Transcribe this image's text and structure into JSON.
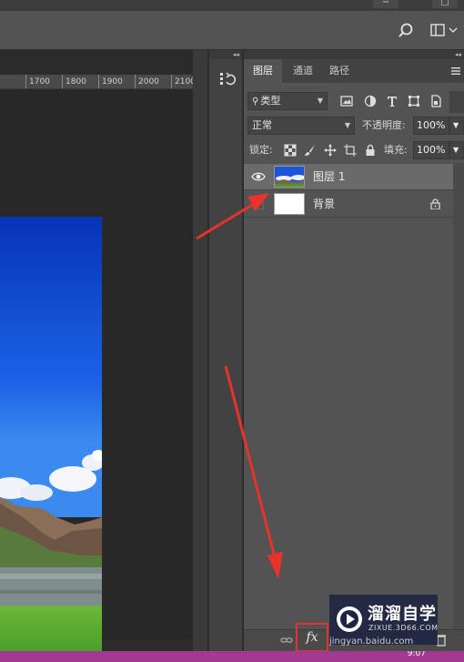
{
  "panel": {
    "tabs": [
      "图层",
      "通道",
      "路径"
    ],
    "filter_kind": "类型",
    "blend_mode": "正常",
    "opacity_label": "不透明度:",
    "opacity_value": "100%",
    "lock_label": "锁定:",
    "fill_label": "填充:",
    "fill_value": "100%",
    "layers": [
      {
        "name": "图层 1",
        "selected": true,
        "visible": true
      },
      {
        "name": "背景",
        "selected": false,
        "visible": false,
        "locked": true
      }
    ],
    "fx_label": "fx"
  },
  "ruler": {
    "ticks": [
      "1700",
      "1800",
      "1900",
      "2000",
      "2100"
    ]
  },
  "watermark": {
    "title": "溜溜自学",
    "subtitle": "ZIXUE.3D66.COM",
    "jingyan": "jingyan.baidu.com"
  },
  "status": {
    "time": "9:07"
  },
  "colors": {
    "annotation_red": "#e8322a",
    "accent_taskbar": "#a23a92"
  }
}
